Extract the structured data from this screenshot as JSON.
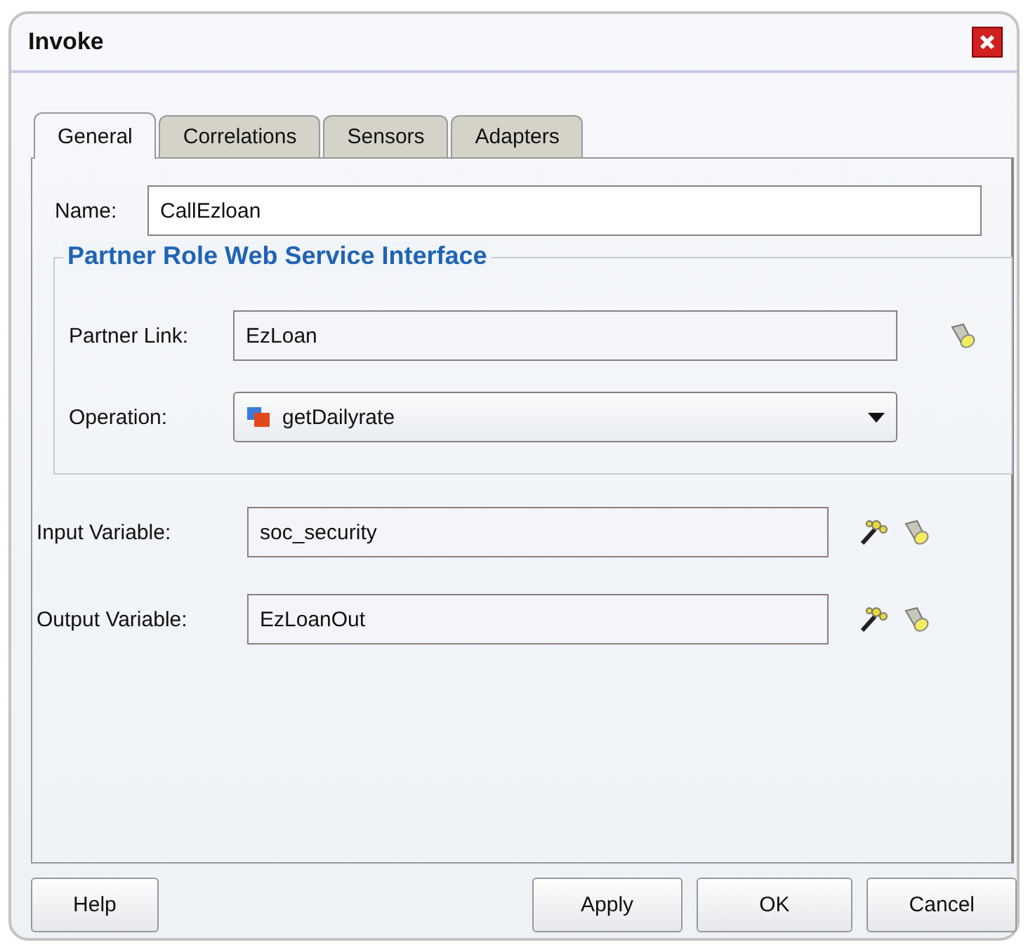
{
  "window": {
    "title": "Invoke"
  },
  "tabs": [
    {
      "label": "General",
      "selected": true
    },
    {
      "label": "Correlations",
      "selected": false
    },
    {
      "label": "Sensors",
      "selected": false
    },
    {
      "label": "Adapters",
      "selected": false
    }
  ],
  "name_field": {
    "label": "Name:",
    "value": "CallEzloan"
  },
  "group": {
    "title": "Partner Role Web Service Interface",
    "fields": [
      {
        "kind": "text",
        "label": "Partner Link:",
        "value": "EzLoan"
      },
      {
        "kind": "dropdown",
        "label": "Operation:",
        "value": "getDailyrate"
      }
    ]
  },
  "variables": [
    {
      "label": "Input Variable:",
      "value": "soc_security"
    },
    {
      "label": "Output Variable:",
      "value": "EzLoanOut"
    }
  ],
  "buttons": [
    "Help",
    "Apply",
    "OK",
    "Cancel"
  ]
}
